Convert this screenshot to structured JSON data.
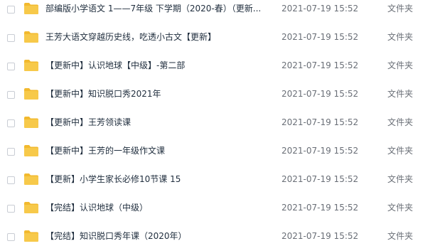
{
  "files": [
    {
      "name": "部编版小学语文 1——7年级 下学期（2020-春）（更新...",
      "modified": "2021-07-19 15:52",
      "type": "文件夹",
      "icon": "folder-icon"
    },
    {
      "name": "王芳大语文穿越历史线，吃透小古文【更新】",
      "modified": "2021-07-19 15:52",
      "type": "文件夹",
      "icon": "folder-icon"
    },
    {
      "name": "【更新中】认识地球【中级】-第二部",
      "modified": "2021-07-19 15:52",
      "type": "文件夹",
      "icon": "folder-icon"
    },
    {
      "name": "【更新中】知识脱口秀2021年",
      "modified": "2021-07-19 15:52",
      "type": "文件夹",
      "icon": "folder-icon"
    },
    {
      "name": "【更新中】王芳领读课",
      "modified": "2021-07-19 15:52",
      "type": "文件夹",
      "icon": "folder-icon"
    },
    {
      "name": "【更新中】王芳的一年级作文课",
      "modified": "2021-07-19 15:52",
      "type": "文件夹",
      "icon": "folder-icon"
    },
    {
      "name": "【更新】小学生家长必修10节课 15",
      "modified": "2021-07-19 15:52",
      "type": "文件夹",
      "icon": "folder-icon"
    },
    {
      "name": "【完结】认识地球（中级）",
      "modified": "2021-07-19 15:52",
      "type": "文件夹",
      "icon": "folder-icon"
    },
    {
      "name": "【完结】知识脱口秀年课（2020年）",
      "modified": "2021-07-19 15:52",
      "type": "文件夹",
      "icon": "folder-icon"
    }
  ],
  "colors": {
    "folder": "#f7c94a",
    "folder_tab": "#f2b92e",
    "name_text": "#1f2d3d",
    "meta_text": "#6a6f77",
    "checkbox_border": "#c9cdd4"
  }
}
